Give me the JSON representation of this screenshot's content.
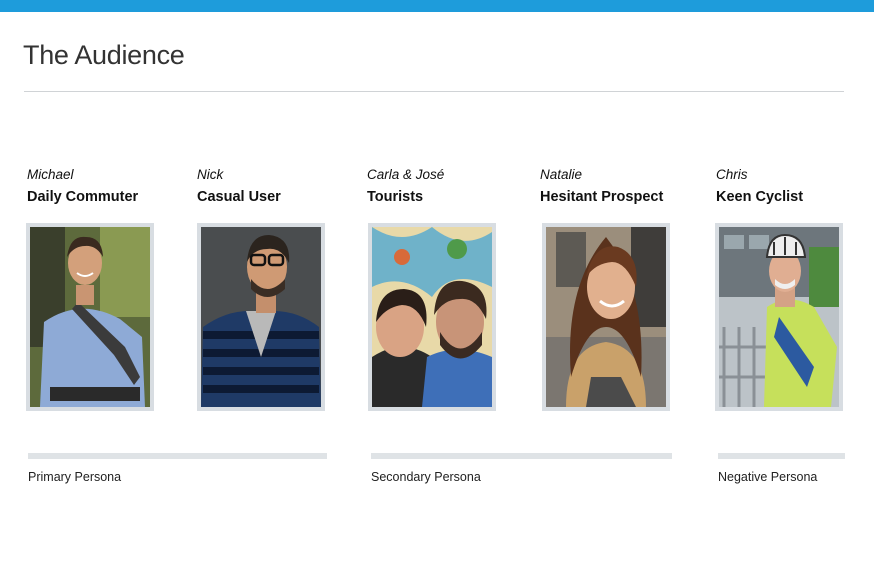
{
  "page": {
    "title": "The Audience"
  },
  "personas": [
    {
      "name": "Michael",
      "role": "Daily Commuter"
    },
    {
      "name": "Nick",
      "role": "Casual User"
    },
    {
      "name": "Carla & José",
      "role": "Tourists"
    },
    {
      "name": "Natalie",
      "role": "Hesitant Prospect"
    },
    {
      "name": "Chris",
      "role": "Keen Cyclist"
    }
  ],
  "groups": [
    {
      "label": "Primary Persona"
    },
    {
      "label": "Secondary Persona"
    },
    {
      "label": "Negative Persona"
    }
  ],
  "colors": {
    "accent": "#1e9cdb",
    "rule": "#d0d3d6",
    "group_bar": "#dfe3e6",
    "photo_border": "#d8dde2"
  }
}
